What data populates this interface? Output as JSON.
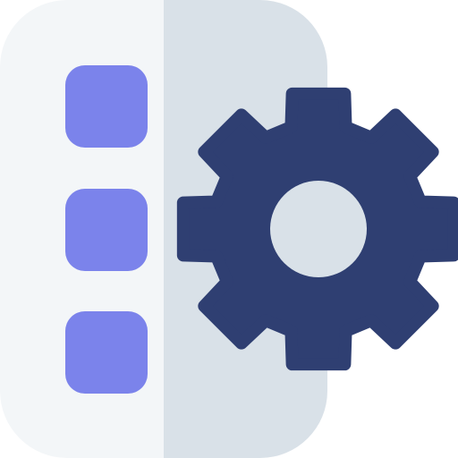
{
  "icon": {
    "name": "settings-document-icon",
    "colors": {
      "page_left": "#F3F6F8",
      "page_right": "#D9E1E8",
      "bullets": "#7B83EB",
      "gear": "#2F3F72",
      "gear_hole": "#D9E1E8"
    },
    "bullet_count": 3
  }
}
